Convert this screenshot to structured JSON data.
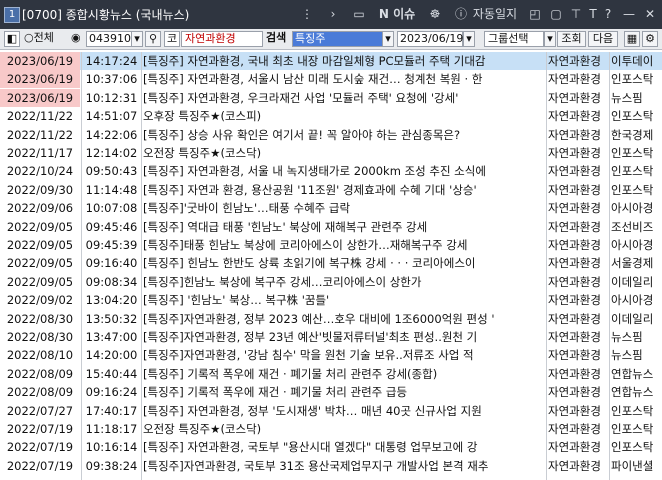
{
  "window": {
    "screen_no": "1",
    "title": "[0700] 종합시황뉴스 (국내뉴스)",
    "menu_news": "N 이슈",
    "menu_auto": "자동일지"
  },
  "filters": {
    "radio_all": "전체",
    "code_value": "043910",
    "code_badge": "코",
    "stock_name": "자연과환경",
    "search_label": "검색",
    "keyword": "특징주",
    "date": "2023/06/19",
    "group_label": "그룹선택",
    "query_button": "조회",
    "next_button": "다음"
  },
  "news": [
    {
      "date": "2023/06/19",
      "time": "14:17:24",
      "title": "[특징주] 자연과환경, 국내 최초 내장 마감일체형 PC모듈러 주택 기대감",
      "category": "자연과환경",
      "source": "이투데이",
      "highlight": true,
      "selected": true
    },
    {
      "date": "2023/06/19",
      "time": "10:37:06",
      "title": "[특징주] 자연과환경, 서울시 남산 미래 도시숲 재건… 청계천 복원 · 한",
      "category": "자연과환경",
      "source": "인포스탁",
      "highlight": true,
      "selected": false
    },
    {
      "date": "2023/06/19",
      "time": "10:12:31",
      "title": "[특징주] 자연과환경, 우크라재건 사업 '모듈러 주택' 요청에 '강세'",
      "category": "자연과환경",
      "source": "뉴스핌",
      "highlight": true,
      "selected": false
    },
    {
      "date": "2022/11/22",
      "time": "14:51:07",
      "title": "오후장 특징주★(코스피)",
      "category": "자연과환경",
      "source": "인포스탁",
      "highlight": false,
      "selected": false
    },
    {
      "date": "2022/11/22",
      "time": "14:22:06",
      "title": "[특징주] 상승 사유 확인은 여기서 끝! 꼭 알아야 하는 관심종목은?",
      "category": "자연과환경",
      "source": "한국경제",
      "highlight": false,
      "selected": false
    },
    {
      "date": "2022/11/17",
      "time": "12:14:02",
      "title": "오전장 특징주★(코스닥)",
      "category": "자연과환경",
      "source": "인포스탁",
      "highlight": false,
      "selected": false
    },
    {
      "date": "2022/10/24",
      "time": "09:50:43",
      "title": "[특징주] 자연과환경, 서울 내 녹지생태가로 2000km 조성 추진 소식에",
      "category": "자연과환경",
      "source": "인포스탁",
      "highlight": false,
      "selected": false
    },
    {
      "date": "2022/09/30",
      "time": "11:14:48",
      "title": "[특징주] 자연과 환경, 용산공원 '11조원' 경제효과에 수혜 기대 '상승'",
      "category": "자연과환경",
      "source": "인포스탁",
      "highlight": false,
      "selected": false
    },
    {
      "date": "2022/09/06",
      "time": "10:07:08",
      "title": "[특징주]'굿바이 힌남노'…태풍 수혜주 급락",
      "category": "자연과환경",
      "source": "아시아경",
      "highlight": false,
      "selected": false
    },
    {
      "date": "2022/09/05",
      "time": "09:45:46",
      "title": "[특징주] 역대급 태풍 '힌남노' 북상에 재해복구 관련주 강세",
      "category": "자연과환경",
      "source": "조선비즈",
      "highlight": false,
      "selected": false
    },
    {
      "date": "2022/09/05",
      "time": "09:45:39",
      "title": "[특징주]태풍 힌남노 북상에 코리아에스이 상한가…재해복구주 강세",
      "category": "자연과환경",
      "source": "아시아경",
      "highlight": false,
      "selected": false
    },
    {
      "date": "2022/09/05",
      "time": "09:16:40",
      "title": "[특징주] 힌남노 한반도 상륙 초읽기에 복구株 강세 · · · 코리아에스이",
      "category": "자연과환경",
      "source": "서울경제",
      "highlight": false,
      "selected": false
    },
    {
      "date": "2022/09/05",
      "time": "09:08:34",
      "title": "[특징주]힌남노 북상에 복구주 강세…코리아에스이 상한가",
      "category": "자연과환경",
      "source": "이데일리",
      "highlight": false,
      "selected": false
    },
    {
      "date": "2022/09/02",
      "time": "13:04:20",
      "title": "[특징주] '힌남노' 북상… 복구株 '꿈틀'",
      "category": "자연과환경",
      "source": "아시아경",
      "highlight": false,
      "selected": false
    },
    {
      "date": "2022/08/30",
      "time": "13:50:32",
      "title": "[특징주]자연과환경, 정부 2023 예산…호우 대비에 1조6000억원 편성 '",
      "category": "자연과환경",
      "source": "이데일리",
      "highlight": false,
      "selected": false
    },
    {
      "date": "2022/08/30",
      "time": "13:47:00",
      "title": "[특징주]자연과환경, 정부 23년 예산'빗물저류터널'최초 편성..원천 기",
      "category": "자연과환경",
      "source": "뉴스핌",
      "highlight": false,
      "selected": false
    },
    {
      "date": "2022/08/10",
      "time": "14:20:00",
      "title": "[특징주]자연과환경, '강남 침수' 막을 원천 기술 보유..저류조 사업 적",
      "category": "자연과환경",
      "source": "뉴스핌",
      "highlight": false,
      "selected": false
    },
    {
      "date": "2022/08/09",
      "time": "15:40:44",
      "title": "[특징주] 기록적 폭우에 재건 · 폐기물 처리 관련주 강세(종합)",
      "category": "자연과환경",
      "source": "연합뉴스",
      "highlight": false,
      "selected": false
    },
    {
      "date": "2022/08/09",
      "time": "09:16:24",
      "title": "[특징주] 기록적 폭우에 재건 · 폐기물 처리 관련주 급등",
      "category": "자연과환경",
      "source": "연합뉴스",
      "highlight": false,
      "selected": false
    },
    {
      "date": "2022/07/27",
      "time": "17:40:17",
      "title": "[특징주] 자연과환경, 정부 '도시재생' 박차… 매년 40곳 신규사업 지원",
      "category": "자연과환경",
      "source": "인포스탁",
      "highlight": false,
      "selected": false
    },
    {
      "date": "2022/07/19",
      "time": "11:18:17",
      "title": "오전장 특징주★(코스닥)",
      "category": "자연과환경",
      "source": "인포스탁",
      "highlight": false,
      "selected": false
    },
    {
      "date": "2022/07/19",
      "time": "10:16:14",
      "title": "[특징주] 자연과환경, 국토부 \"용산시대 열겠다\" 대통령 업무보고에 강",
      "category": "자연과환경",
      "source": "인포스탁",
      "highlight": false,
      "selected": false
    },
    {
      "date": "2022/07/19",
      "time": "09:38:24",
      "title": "[특징주]자연과환경, 국토부 31조 용산국제업무지구 개발사업 본격 재추",
      "category": "자연과환경",
      "source": "파이낸셜",
      "highlight": false,
      "selected": false
    }
  ]
}
